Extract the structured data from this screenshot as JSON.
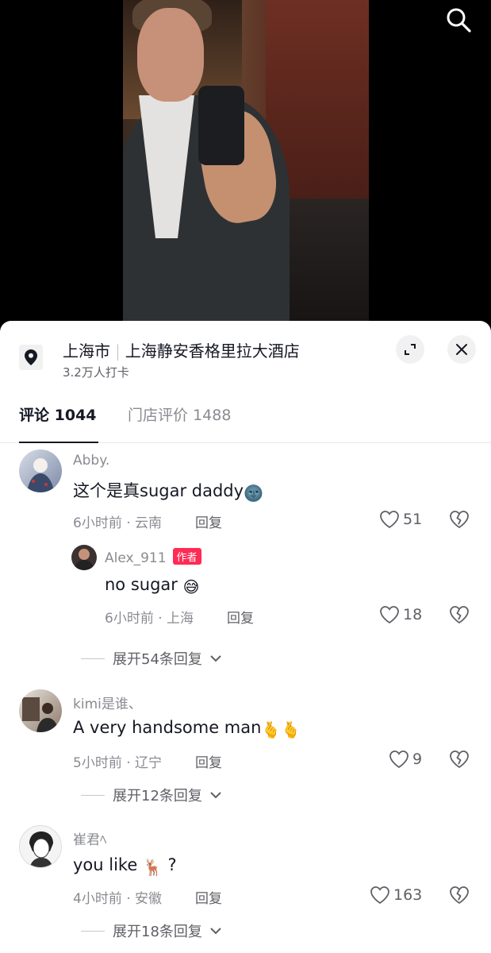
{
  "location": {
    "city": "上海市",
    "place": "上海静安香格里拉大酒店",
    "checkins": "3.2万人打卡"
  },
  "tabs": {
    "comments_label": "评论",
    "comments_count": "1044",
    "reviews_label": "门店评价",
    "reviews_count": "1488"
  },
  "comments": [
    {
      "user": "Abby.",
      "text": "这个是真sugar daddy",
      "emoji": "🌚",
      "meta": "6小时前 · 云南",
      "reply": "回复",
      "likes": "51",
      "replies": [
        {
          "user": "Alex_911",
          "badge": "作者",
          "text": "no sugar",
          "emoji": "😅",
          "meta": "6小时前 · 上海",
          "reply": "回复",
          "likes": "18"
        }
      ],
      "expand": "展开54条回复"
    },
    {
      "user": "kimi是谁、",
      "text": "A very handsome man",
      "emoji": "🫰🫰",
      "meta": "5小时前 · 辽宁",
      "reply": "回复",
      "likes": "9",
      "expand": "展开12条回复"
    },
    {
      "user": "崔君ﾍ",
      "text": "you like",
      "emoji": "🦌",
      "text_suffix": "?",
      "meta": "4小时前 · 安徽",
      "reply": "回复",
      "likes": "163",
      "expand": "展开18条回复"
    }
  ],
  "colors": {
    "accent": "#fe2c55",
    "text_primary": "#161823",
    "text_secondary": "#8a8b91"
  }
}
